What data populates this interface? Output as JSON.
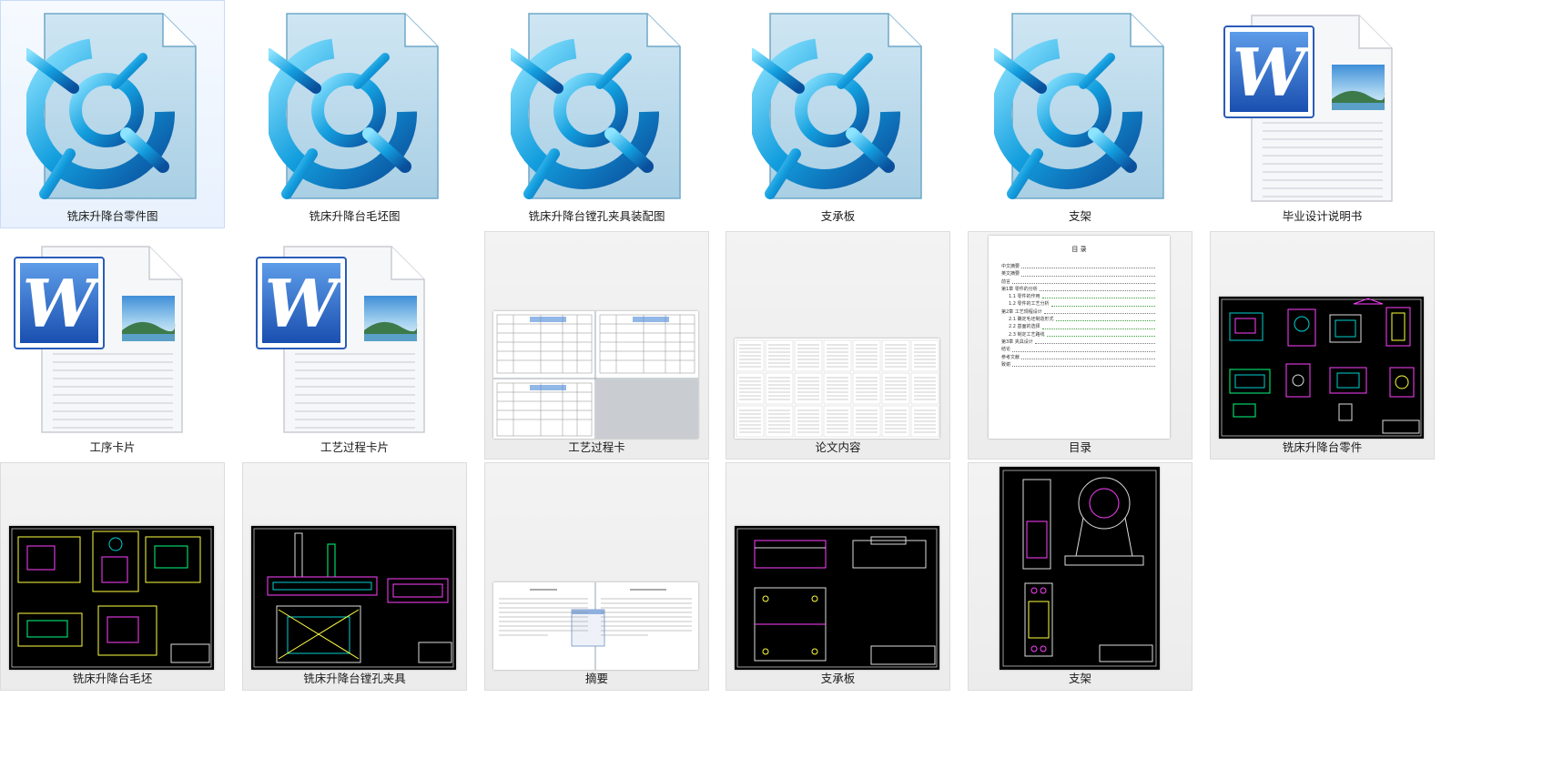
{
  "files": [
    {
      "name": "铣床升降台零件图",
      "type": "cad-document",
      "icon": "cad-file-icon"
    },
    {
      "name": "铣床升降台毛坯图",
      "type": "cad-document",
      "icon": "cad-file-icon"
    },
    {
      "name": "铣床升降台镗孔夹具装配图",
      "type": "cad-document",
      "icon": "cad-file-icon"
    },
    {
      "name": "支承板",
      "type": "cad-document",
      "icon": "cad-file-icon"
    },
    {
      "name": "支架",
      "type": "cad-document",
      "icon": "cad-file-icon"
    },
    {
      "name": "毕业设计说明书",
      "type": "word-document",
      "icon": "word-file-icon"
    },
    {
      "name": "工序卡片",
      "type": "word-document",
      "icon": "word-file-icon"
    },
    {
      "name": "工艺过程卡片",
      "type": "word-document",
      "icon": "word-file-icon"
    },
    {
      "name": "工艺过程卡",
      "type": "image",
      "icon": "process-card-thumbnail"
    },
    {
      "name": "论文内容",
      "type": "image",
      "icon": "thesis-pages-thumbnail"
    },
    {
      "name": "目录",
      "type": "image",
      "icon": "table-of-contents-thumbnail"
    },
    {
      "name": "铣床升降台零件",
      "type": "image",
      "icon": "cad-drawing-thumbnail"
    },
    {
      "name": "铣床升降台毛坯",
      "type": "image",
      "icon": "cad-drawing-thumbnail"
    },
    {
      "name": "铣床升降台镗孔夹具",
      "type": "image",
      "icon": "cad-drawing-thumbnail"
    },
    {
      "name": "摘要",
      "type": "image",
      "icon": "abstract-pages-thumbnail"
    },
    {
      "name": "支承板",
      "type": "image",
      "icon": "cad-drawing-thumbnail"
    },
    {
      "name": "支架",
      "type": "image",
      "icon": "cad-drawing-thumbnail"
    }
  ],
  "toc_thumbnail": {
    "title": "目 录",
    "entries": [
      "中文摘要",
      "英文摘要",
      "前言",
      "第1章 零件的分析",
      "1.1 零件的作用",
      "1.2 零件的工艺分析",
      "第2章 工艺规程设计",
      "2.1 确定毛坯制造形式",
      "2.2 基面的选择",
      "2.3 制定工艺路线",
      "第3章 夹具设计",
      "结论",
      "参考文献",
      "致谢"
    ]
  },
  "colors": {
    "selection_bg": "#e8f1fd",
    "selection_border": "#c9dcf5",
    "thumb_bg": "#ececec"
  }
}
